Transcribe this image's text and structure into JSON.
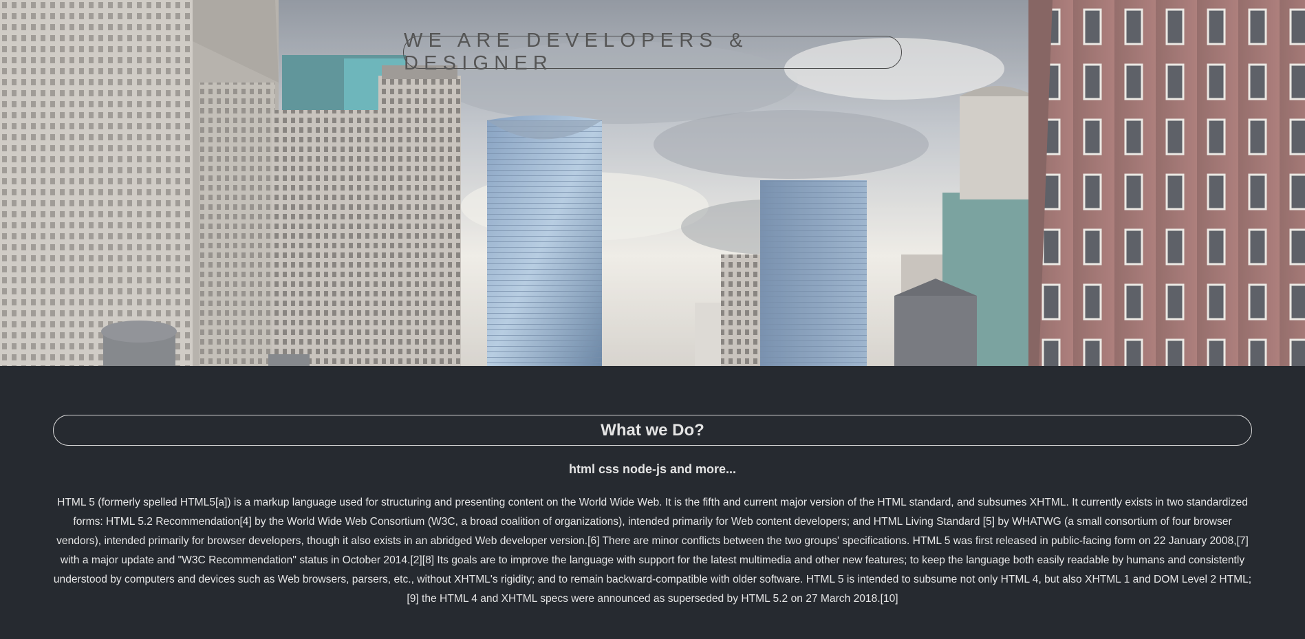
{
  "hero": {
    "title": "WE ARE DEVELOPERS & DESIGNER",
    "background_image": "city-skyline-photo"
  },
  "section": {
    "heading": "What we Do?",
    "subheading": "html css node-js and more...",
    "paragraph": "HTML 5 (formerly spelled HTML5[a]) is a markup language used for structuring and presenting content on the World Wide Web. It is the fifth and current major version of the HTML standard, and subsumes XHTML. It currently exists in two standardized forms: HTML 5.2 Recommendation[4] by the World Wide Web Consortium (W3C, a broad coalition of organizations), intended primarily for Web content developers; and HTML Living Standard [5] by WHATWG (a small consortium of four browser vendors), intended primarily for browser developers, though it also exists in an abridged Web developer version.[6] There are minor conflicts between the two groups' specifications. HTML 5 was first released in public-facing form on 22 January 2008,[7] with a major update and \"W3C Recommendation\" status in October 2014.[2][8] Its goals are to improve the language with support for the latest multimedia and other new features; to keep the language both easily readable by humans and consistently understood by computers and devices such as Web browsers, parsers, etc., without XHTML's rigidity; and to remain backward-compatible with older software. HTML 5 is intended to subsume not only HTML 4, but also XHTML 1 and DOM Level 2 HTML;[9] the HTML 4 and XHTML specs were announced as superseded by HTML 5.2 on 27 March 2018.[10]"
  },
  "colors": {
    "page_background": "#262a30",
    "text": "#e4e4e4",
    "hero_title": "#555555"
  }
}
